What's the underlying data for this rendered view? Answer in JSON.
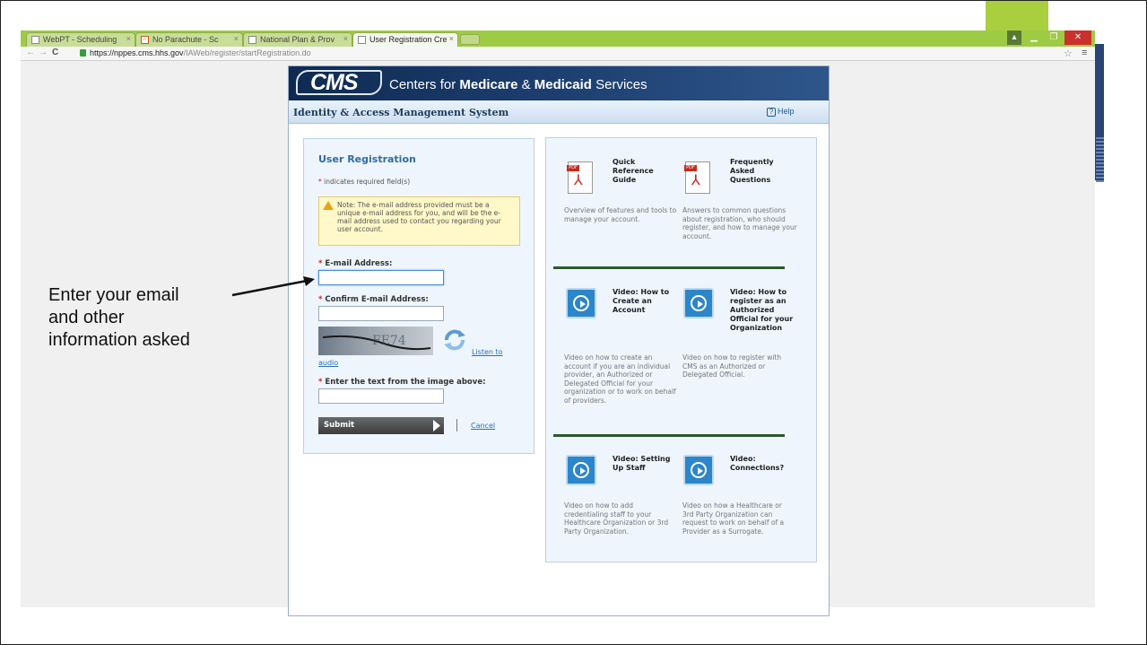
{
  "browser": {
    "tabs": [
      {
        "label": "WebPT - Scheduling"
      },
      {
        "label": "No Parachute - Sc"
      },
      {
        "label": "National Plan & Prov"
      },
      {
        "label": "User Registration Cre"
      }
    ],
    "url_domain": "https://nppes.cms.hhs.gov",
    "url_path": "/IAWeb/register/startRegistration.do"
  },
  "cms": {
    "logo": "CMS",
    "title_prefix": "Centers for ",
    "title_bold1": "Medicare",
    "title_amp": " & ",
    "title_bold2": "Medicaid",
    "title_suffix": " Services"
  },
  "iam": {
    "title": "Identity & Access Management System",
    "help": "Help"
  },
  "form": {
    "title": "User Registration",
    "required_note": "indicates required field(s)",
    "note": "Note: The e-mail address provided must be a unique e-mail address for you, and will be the e-mail address used to contact you regarding your user account.",
    "email_label": "E-mail Address:",
    "confirm_email_label": "Confirm E-mail Address:",
    "listen_label": "Listen to",
    "audio_label": "audio",
    "captcha_label": "Enter the text from the image above:",
    "submit_label": "Submit",
    "cancel_label": "Cancel"
  },
  "resources": [
    {
      "icon": "pdf-icon",
      "title": "Quick Reference Guide",
      "desc": "Overview of features and tools to manage your account."
    },
    {
      "icon": "pdf-icon",
      "title": "Frequently Asked Questions",
      "desc": "Answers to common questions about registration, who should register, and how to manage your account."
    },
    {
      "icon": "play-icon",
      "title": "Video: How to Create an Account",
      "desc": "Video on how to create an account if you are an individual provider, an Authorized or Delegated Official for your organization or to work on behalf of providers."
    },
    {
      "icon": "play-icon",
      "title": "Video: How to register as an Authorized Official for your Organization",
      "desc": "Video on how to register with CMS as an Authorized or Delegated Official."
    },
    {
      "icon": "play-icon",
      "title": "Video: Setting Up Staff",
      "desc": "Video on how to add credentialing staff to your Healthcare Organization or 3rd Party Organization."
    },
    {
      "icon": "play-icon",
      "title": "Video: Connections?",
      "desc": "Video on how a Healthcare or 3rd Party Organization can request to work on behalf of a Provider as a Surrogate."
    }
  ],
  "callout": {
    "line1": "Enter your email",
    "line2": "and other",
    "line3": "information asked"
  }
}
